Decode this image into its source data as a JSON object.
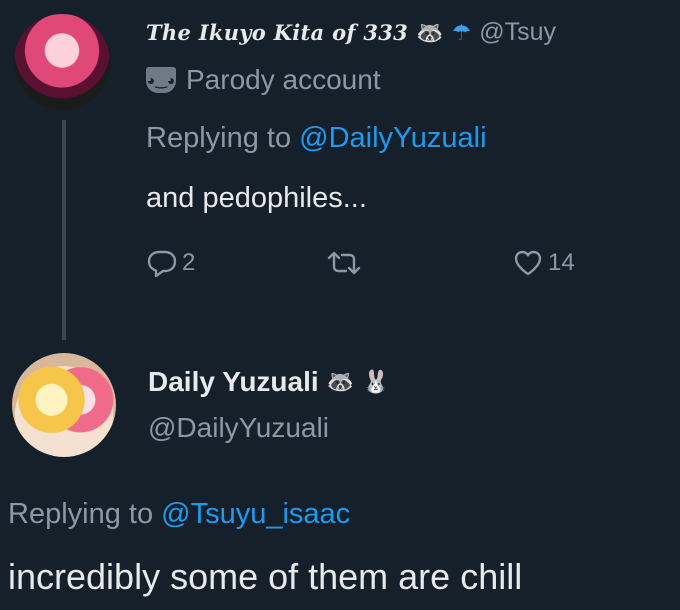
{
  "tweet1": {
    "display_name": "The Ikuyo Kita of 333",
    "handle": "@Tsuy",
    "badge_label": "Parody account",
    "replying_prefix": "Replying to ",
    "replying_to": "@DailyYuzuali",
    "text": "and pedophiles...",
    "reply_count": "2",
    "like_count": "14",
    "icons": [
      "raccoon-emoji",
      "umbrella-emoji",
      "parody-mask-icon",
      "reply-icon",
      "repost-icon",
      "like-icon"
    ]
  },
  "tweet2": {
    "display_name": "Daily Yuzuali",
    "handle": "@DailyYuzuali",
    "replying_prefix": "Replying to ",
    "replying_to": "@Tsuyu_isaac",
    "text": "incredibly some of them are chill",
    "icons": [
      "raccoon-emoji",
      "rabbit-emoji"
    ]
  },
  "colors": {
    "background": "#15202b",
    "text_primary": "#e7e9ea",
    "text_secondary": "#8b98a5",
    "link": "#1d9bf0"
  }
}
